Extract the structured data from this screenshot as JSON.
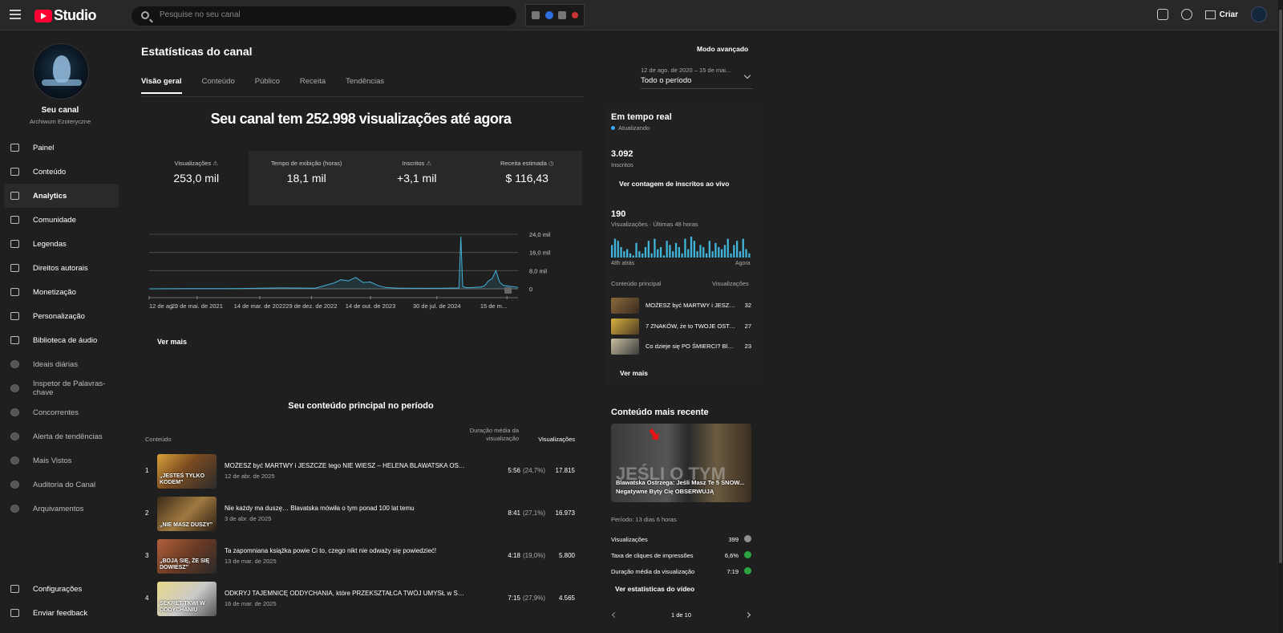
{
  "header": {
    "logo_text": "Studio",
    "search_placeholder": "Pesquise no seu canal",
    "create_label": "Criar"
  },
  "sidebar": {
    "channel_name": "Seu canal",
    "channel_handle": "Archiwum Ezoteryczne",
    "items": [
      {
        "label": "Painel",
        "icon": "dashboard-icon",
        "active": false
      },
      {
        "label": "Conteúdo",
        "icon": "content-icon",
        "active": false
      },
      {
        "label": "Analytics",
        "icon": "analytics-icon",
        "active": true
      },
      {
        "label": "Comunidade",
        "icon": "community-icon",
        "active": false
      },
      {
        "label": "Legendas",
        "icon": "subtitles-icon",
        "active": false
      },
      {
        "label": "Direitos autorais",
        "icon": "copyright-icon",
        "active": false
      },
      {
        "label": "Monetização",
        "icon": "dollar-icon",
        "active": false
      },
      {
        "label": "Personalização",
        "icon": "wand-icon",
        "active": false
      },
      {
        "label": "Biblioteca de áudio",
        "icon": "audio-library-icon",
        "active": false
      }
    ],
    "ext_items": [
      {
        "label": "Ideais diárias",
        "icon": "extension-icon"
      },
      {
        "label": "Inspetor de Palavras-chave",
        "icon": "extension-icon"
      },
      {
        "label": "Concorrentes",
        "icon": "extension-icon"
      },
      {
        "label": "Alerta de tendências",
        "icon": "extension-icon"
      },
      {
        "label": "Mais Vistos",
        "icon": "extension-icon"
      },
      {
        "label": "Auditoria do Canal",
        "icon": "extension-icon"
      },
      {
        "label": "Arquivamentos",
        "icon": "extension-icon"
      }
    ],
    "bottom": [
      {
        "label": "Configurações",
        "icon": "gear-icon"
      },
      {
        "label": "Enviar feedback",
        "icon": "feedback-icon"
      }
    ]
  },
  "main": {
    "title": "Estatísticas do canal",
    "advanced_mode": "Modo avançado",
    "tabs": [
      "Visão geral",
      "Conteúdo",
      "Público",
      "Receita",
      "Tendências"
    ],
    "period_range": "12 de ago. de 2020 – 15 de mai...",
    "period_label": "Todo o período",
    "headline": "Seu canal tem 252.998 visualizações até agora",
    "metrics": [
      {
        "label": "Visualizações",
        "value": "253,0 mil",
        "icon": "warning-icon"
      },
      {
        "label": "Tempo de exibição (horas)",
        "value": "18,1 mil",
        "icon": ""
      },
      {
        "label": "Inscritos",
        "value": "+3,1 mil",
        "icon": "warning-icon"
      },
      {
        "label": "Receita estimada",
        "value": "$ 116,43",
        "icon": "clock-icon"
      }
    ],
    "see_more": "Ver mais"
  },
  "chart_data": {
    "type": "area",
    "y_ticks": [
      "24,0 mil",
      "16,0 mil",
      "8,0 mil",
      "0"
    ],
    "x_ticks": [
      "12 de ag...",
      "29 de mai. de 2021",
      "14 de mar. de 2022",
      "29 de dez. de 2022",
      "14 de out. de 2023",
      "30 de jul. de 2024",
      "15 de m..."
    ],
    "ylim": [
      0,
      24000
    ],
    "x": [
      0,
      5,
      10,
      15,
      20,
      25,
      30,
      35,
      40,
      45,
      50,
      52,
      54,
      56,
      58,
      60,
      62,
      64,
      66,
      68,
      70,
      75,
      80,
      84,
      84.5,
      85,
      86,
      88,
      90,
      91,
      92,
      93,
      94,
      95,
      96,
      100
    ],
    "values": [
      0,
      50,
      80,
      100,
      120,
      150,
      300,
      400,
      350,
      300,
      2500,
      4000,
      3500,
      5000,
      2800,
      3000,
      1500,
      600,
      400,
      300,
      250,
      200,
      300,
      400,
      23000,
      1000,
      500,
      600,
      800,
      1500,
      3500,
      4500,
      8000,
      3000,
      1500,
      600
    ]
  },
  "top_content": {
    "title": "Seu conteúdo principal no período",
    "col_content": "Conteúdo",
    "col_duration": "Duração média da visualização",
    "col_views": "Visualizações",
    "rows": [
      {
        "rank": "1",
        "title": "MOŻESZ być MARTWY i JESZCZE tego NIE WIESZ – HELENA BLAWATSKA OSTR...",
        "date": "12 de abr. de 2025",
        "duration": "5:56",
        "pct": "(24,7%)",
        "views": "17.815"
      },
      {
        "rank": "2",
        "title": "Nie każdy ma duszę… Blavatska mówiła o tym ponad 100 lat temu",
        "date": "3 de abr. de 2025",
        "duration": "8:41",
        "pct": "(27,1%)",
        "views": "16.973"
      },
      {
        "rank": "3",
        "title": "Ta zapomniana książka powie Ci to, czego nikt nie odważy się powiedzieć!",
        "date": "13 de mar. de 2025",
        "duration": "4:18",
        "pct": "(19,0%)",
        "views": "5.800"
      },
      {
        "rank": "4",
        "title": "ODKRYJ TAJEMNICĘ ODDYCHANIA, które PRZEKSZTAŁCA TWÓJ UMYSŁ w SEK...",
        "date": "16 de mar. de 2025",
        "duration": "7:15",
        "pct": "(27,9%)",
        "views": "4.565"
      }
    ],
    "thumb_texts": [
      "„JESTEŚ TYLKO KODEM”",
      "„NIE MASZ DUSZY”",
      "„BOJĄ SIĘ, ŻE SIĘ DOWIESZ”",
      "SEKRET TKWI W ODDYCHANIU"
    ]
  },
  "realtime": {
    "title": "Em tempo real",
    "status": "Atualizando",
    "subs_value": "3.092",
    "subs_label": "Inscritos",
    "live_button": "Ver contagem de inscritos ao vivo",
    "views_value": "190",
    "views_label": "Visualizações · Últimas 48 horas",
    "bars_left": "48h atrás",
    "bars_right": "Agora",
    "bars": [
      6,
      9,
      8,
      5,
      3,
      4,
      2,
      1,
      7,
      3,
      2,
      5,
      8,
      2,
      9,
      4,
      5,
      1,
      8,
      6,
      3,
      7,
      5,
      2,
      9,
      4,
      10,
      8,
      3,
      6,
      5,
      2,
      8,
      3,
      7,
      5,
      4,
      6,
      9,
      2,
      6,
      8,
      3,
      9,
      4,
      2
    ],
    "tc_header": "Conteúdo principal",
    "tc_views_header": "Visualizações",
    "rows": [
      {
        "title": "MOŻESZ być MARTWY i JESZCZE tego NIE WIESZ",
        "views": "32"
      },
      {
        "title": "7 ZNAKÓW, że to TWOJE OSTATNIE WCIELENIE",
        "views": "27"
      },
      {
        "title": "Co dzieje się PO ŚMIERCI? Blawatska",
        "views": "23"
      }
    ],
    "see_more": "Ver mais"
  },
  "recent": {
    "title": "Conteúdo mais recente",
    "video_title": "Blawatska Ostrzega: Jeśli Masz Te 5 SNOW... Negatywne Byty Cię OBSERWUJĄ",
    "thumb_overlay": "JEŚLI O TYM",
    "period": "Período: 13 dias 6 horas",
    "stats": [
      {
        "label": "Visualizações",
        "value": "399",
        "badge_color": "#909090"
      },
      {
        "label": "Taxa de cliques de impressões",
        "value": "6,6%",
        "badge_color": "#2ba640"
      },
      {
        "label": "Duração média da visualização",
        "value": "7:19",
        "badge_color": "#2ba640"
      }
    ],
    "stats_button": "Ver estatísticas do vídeo",
    "pager": "1 de 10"
  },
  "colors": {
    "accent": "#3ea6ff",
    "chart_line": "#41b4d9"
  }
}
